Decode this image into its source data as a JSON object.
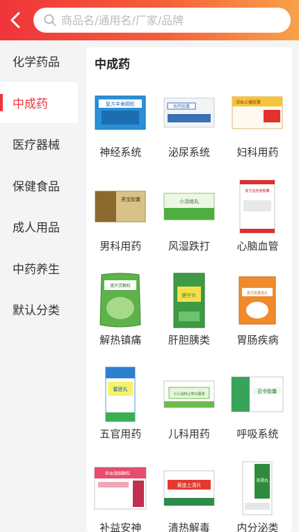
{
  "header": {
    "search_placeholder": "商品名/通用名/厂家/品牌"
  },
  "sidebar": {
    "items": [
      {
        "label": "化学药品",
        "active": false
      },
      {
        "label": "中成药",
        "active": true
      },
      {
        "label": "医疗器械",
        "active": false
      },
      {
        "label": "保健食品",
        "active": false
      },
      {
        "label": "成人用品",
        "active": false
      },
      {
        "label": "中药养生",
        "active": false
      },
      {
        "label": "默认分类",
        "active": false
      }
    ]
  },
  "main": {
    "section_title": "中成药",
    "categories": [
      {
        "label": "神经系统",
        "box_text": "复方羊角颗粒"
      },
      {
        "label": "泌尿系统",
        "box_text": "尚药胶囊"
      },
      {
        "label": "妇科用药",
        "box_text": "活血止痛胶囊"
      },
      {
        "label": "男科用药",
        "box_text": "男宝胶囊"
      },
      {
        "label": "风湿跌打",
        "box_text": "小活络丸"
      },
      {
        "label": "心脑血管",
        "box_text": "复方血栓通胶囊"
      },
      {
        "label": "解热镇痛",
        "box_text": "清开灵颗粒"
      },
      {
        "label": "肝胆胰类",
        "box_text": "胆宁片"
      },
      {
        "label": "胃肠疾病",
        "box_text": "复方陈香胃片"
      },
      {
        "label": "五官用药",
        "box_text": "藿胆丸"
      },
      {
        "label": "儿科用药",
        "box_text": "小儿消积止咳口服液"
      },
      {
        "label": "呼吸系统",
        "box_text": "百令胶囊"
      },
      {
        "label": "补益安神",
        "box_text": "养血清脑颗粒"
      },
      {
        "label": "清热解毒",
        "box_text": "黄连上清片"
      },
      {
        "label": "内分泌类",
        "box_text": "消渴丸"
      }
    ]
  },
  "colors": {
    "brand": "#f0343a",
    "header_gradient_end": "#f8a24a"
  },
  "icons": {
    "back": "chevron-left-icon",
    "search": "search-icon"
  }
}
